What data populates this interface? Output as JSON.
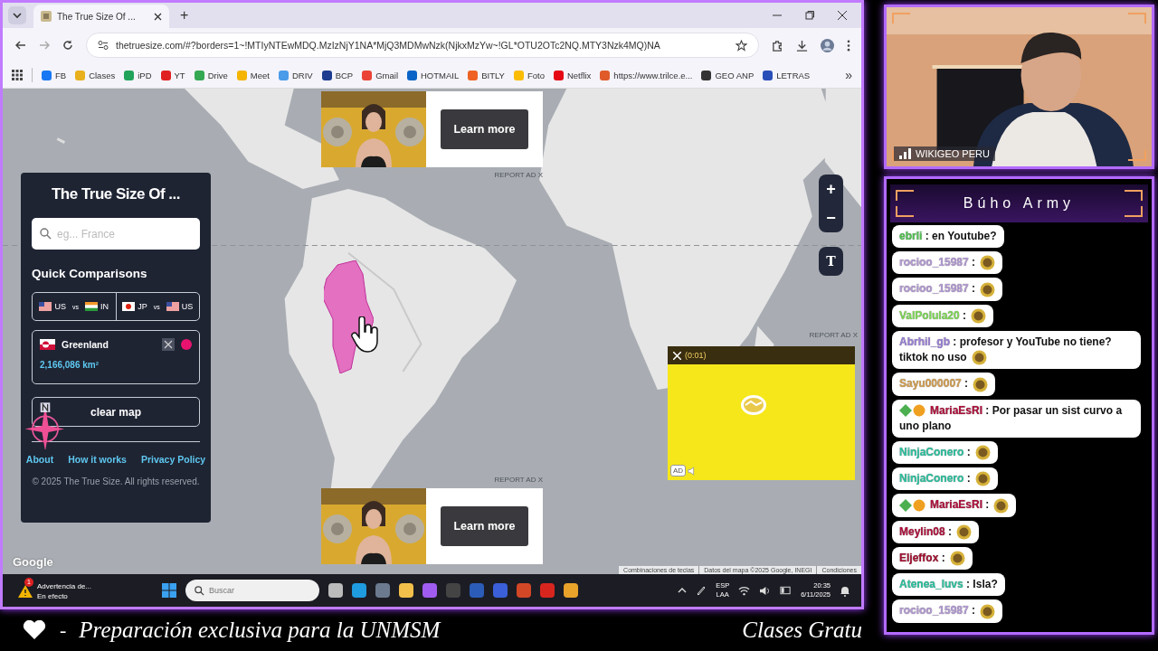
{
  "browser": {
    "tab_title": "The True Size Of ...",
    "new_tab": "+",
    "url": "thetruesize.com/#?borders=1~!MTIyNTEwMDQ.MzIzNjY1NA*MjQ3MDMwNzk(NjkxMzYw~!GL*OTU2OTc2NQ.MTY3Nzk4MQ)NA",
    "bookmarks": [
      "FB",
      "Clases",
      "iPD",
      "YT",
      "Drive",
      "Meet",
      "DRIV",
      "BCP",
      "Gmail",
      "HOTMAIL",
      "BITLY",
      "Foto",
      "Netflix",
      "https://www.trilce.e...",
      "GEO ANP",
      "LETRAS"
    ],
    "more": "»"
  },
  "map": {
    "logo": "Google",
    "footer": [
      "Combinaciones de teclas",
      "Datos del mapa ©2025 Google, INEGI",
      "Condiciones"
    ],
    "zoom_in": "+",
    "zoom_out": "−",
    "text_button": "T"
  },
  "panel": {
    "title": "The True Size Of ...",
    "search": {
      "placeholder": "eg... France"
    },
    "quick_title": "Quick Comparisons",
    "comparisons": [
      {
        "a": "US",
        "vs": "vs",
        "b": "IN"
      },
      {
        "a": "JP",
        "vs": "vs",
        "b": "US"
      }
    ],
    "countries": [
      {
        "name": "Greenland",
        "area": "2,166,086 km²",
        "color": "#e8136e"
      }
    ],
    "clear": "clear map",
    "links": [
      "About",
      "How it works",
      "Privacy Policy"
    ],
    "copyright": "© 2025 The True Size. All rights reserved."
  },
  "ads": [
    {
      "button": "Learn more",
      "report": "REPORT AD X"
    },
    {
      "button": "Learn more",
      "report": "REPORT AD X"
    }
  ],
  "video_ad": {
    "timer": "(0:01)",
    "badge": "AD",
    "report": "REPORT AD X"
  },
  "taskbar": {
    "alert_count": "1",
    "alert_title": "Advertencia de...",
    "alert_sub": "En efecto",
    "search": {
      "placeholder": "Buscar"
    },
    "lang": "ESP",
    "layout": "LAA",
    "time": "20:35",
    "date": "6/11/2025"
  },
  "webcam": {
    "name": "WIKIGEO PERU"
  },
  "chat": {
    "title": "Búho Army",
    "messages": [
      {
        "user": "ebrli",
        "color": "#4fc24f",
        "text": ": en Youtube?",
        "badges": false,
        "emote": false
      },
      {
        "user": "rocioo_15987",
        "color": "#b49ad6",
        "text": ":",
        "badges": false,
        "emote": true
      },
      {
        "user": "rocioo_15987",
        "color": "#b49ad6",
        "text": ":",
        "badges": false,
        "emote": true
      },
      {
        "user": "ValPolula20",
        "color": "#7ed957",
        "text": ":",
        "badges": false,
        "emote": true
      },
      {
        "user": "Abrhil_gb",
        "color": "#9a7fd8",
        "text": ": profesor y YouTube no tiene? tiktok no uso",
        "badges": false,
        "emote": true
      },
      {
        "user": "Sayu000007",
        "color": "#d4a050",
        "text": ":",
        "badges": false,
        "emote": true
      },
      {
        "user": "MariaEsRI",
        "color": "#b0103c",
        "text": ": Por pasar un sist curvo a uno plano",
        "badges": true,
        "emote": false
      },
      {
        "user": "NinjaConero",
        "color": "#2cc3a0",
        "text": ":",
        "badges": false,
        "emote": true
      },
      {
        "user": "NinjaConero",
        "color": "#2cc3a0",
        "text": ":",
        "badges": false,
        "emote": true
      },
      {
        "user": "MariaEsRI",
        "color": "#b0103c",
        "text": ":",
        "badges": true,
        "emote": true
      },
      {
        "user": "Meylin08",
        "color": "#b0103c",
        "text": ":",
        "badges": false,
        "emote": true
      },
      {
        "user": "Eljeffox",
        "color": "#a31030",
        "text": ":",
        "badges": false,
        "emote": true
      },
      {
        "user": "Atenea_luvs",
        "color": "#2cc3a0",
        "text": ": Isla?",
        "badges": false,
        "emote": false
      },
      {
        "user": "rocioo_15987",
        "color": "#b49ad6",
        "text": ":",
        "badges": false,
        "emote": true
      }
    ]
  },
  "ticker": {
    "dash": "-",
    "text": "Preparación exclusiva para la UNMSM",
    "text_right": "Clases Gratu"
  }
}
